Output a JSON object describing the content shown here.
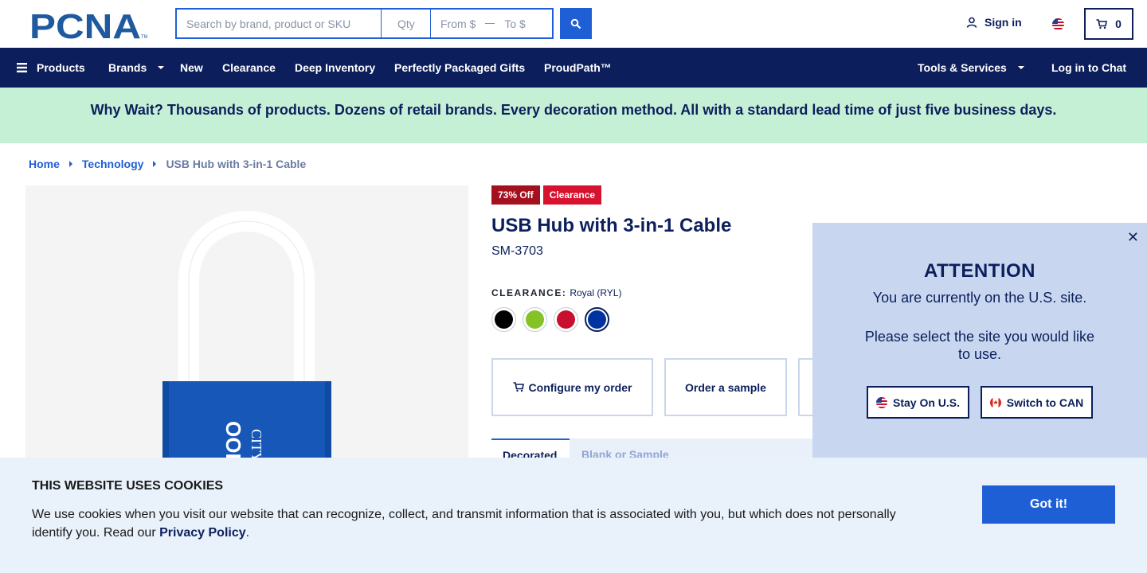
{
  "header": {
    "logo_text": "PCNA",
    "search_placeholder": "Search by brand, product or SKU",
    "qty_placeholder": "Qty",
    "from_placeholder": "From $",
    "to_placeholder": "To $",
    "signin_label": "Sign in",
    "cart_count": "0"
  },
  "nav": {
    "products": "Products",
    "brands": "Brands",
    "new": "New",
    "clearance": "Clearance",
    "deep_inventory": "Deep Inventory",
    "gifts": "Perfectly Packaged Gifts",
    "proudpath": "ProudPath™",
    "tools": "Tools & Services",
    "chat": "Log in to Chat"
  },
  "banner": {
    "text": "Why Wait? Thousands of products. Dozens of retail brands. Every decoration method. All with a standard lead time of just five business days."
  },
  "breadcrumb": {
    "home": "Home",
    "category": "Technology",
    "current": "USB Hub with 3-in-1 Cable"
  },
  "product": {
    "badge_off": "73% Off",
    "badge_clearance": "Clearance",
    "title": "USB Hub with 3-in-1 Cable",
    "sku": "SM-3703",
    "color_label": "CLEARANCE:",
    "color_value": "Royal (RYL)",
    "swatches": [
      "#000000",
      "#84c225",
      "#c8102e",
      "#0033a0"
    ],
    "configure_label": "Configure my order",
    "sample_label": "Order a sample",
    "tab_active": "Decorated",
    "tab_other": "Blank or Sample",
    "image_print": "OOK",
    "image_print2": "CITY"
  },
  "attention": {
    "title": "ATTENTION",
    "line1": "You are currently on the U.S. site.",
    "line2": "Please select the site you would like to use.",
    "stay_label": "Stay On U.S.",
    "switch_label": "Switch to CAN"
  },
  "cookie": {
    "title": "THIS WEBSITE USES COOKIES",
    "message": "We use cookies when you visit our website that can recognize, collect, and transmit information that is associated with you, but which does not personally identify you. Read our",
    "policy_link": "Privacy Policy",
    "period": ".",
    "button": "Got it!"
  },
  "colors": {
    "navy": "#0c1f5c",
    "blue": "#1f5fd6",
    "banner_green": "#c6f0d6",
    "attention_bg": "#c8d7ef",
    "cookie_bg": "#e9f1fb"
  }
}
